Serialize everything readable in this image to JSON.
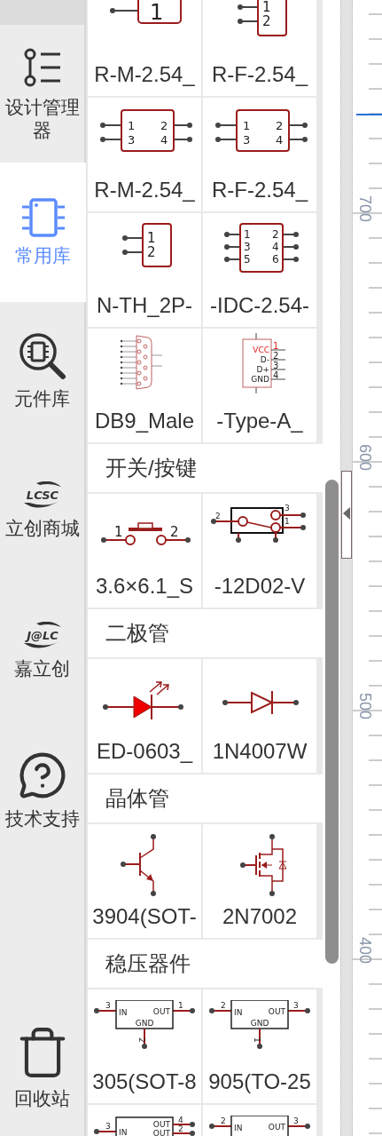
{
  "sidebar": {
    "items": [
      {
        "kind": "tree",
        "label": "设计管理器",
        "selected": false
      },
      {
        "kind": "chip",
        "label": "常用库",
        "selected": true
      },
      {
        "kind": "chip-search",
        "label": "元件库",
        "selected": false
      },
      {
        "kind": "logo",
        "logo_text": "LCSC",
        "label": "立创商城",
        "selected": false
      },
      {
        "kind": "logo",
        "logo_text": "J@LC",
        "label": "嘉立创",
        "selected": false
      },
      {
        "kind": "help",
        "label": "技术支持",
        "selected": false
      },
      {
        "kind": "trash",
        "label": "回收站",
        "selected": false
      }
    ]
  },
  "library": {
    "sections": [
      {
        "rows": [
          [
            {
              "kind": "header-1",
              "name": "R-M-2.54_",
              "pins": [
                "1"
              ]
            },
            {
              "kind": "header-2",
              "name": "R-F-2.54_",
              "pins": [
                "1",
                "2"
              ]
            }
          ],
          [
            {
              "kind": "header-4",
              "name": "R-M-2.54_",
              "pins": [
                "1",
                "2",
                "3",
                "4"
              ]
            },
            {
              "kind": "header-4",
              "name": "R-F-2.54_",
              "pins": [
                "1",
                "2",
                "3",
                "4"
              ]
            }
          ],
          [
            {
              "kind": "header-2",
              "name": "N-TH_2P-",
              "pins": [
                "1",
                "2"
              ]
            },
            {
              "kind": "header-6",
              "name": "-IDC-2.54-",
              "pins": [
                "1",
                "2",
                "3",
                "4",
                "5",
                "6"
              ]
            }
          ],
          [
            {
              "kind": "db9",
              "name": "DB9_Male"
            },
            {
              "kind": "usb",
              "name": "-Type-A_",
              "pins": [
                "VCC",
                "D-",
                "D+",
                "GND",
                "1",
                "2",
                "3",
                "4"
              ]
            }
          ]
        ]
      },
      {
        "title": "开关/按键",
        "rows": [
          [
            {
              "kind": "push-button",
              "name": "3.6×6.1_S",
              "pins": [
                "1",
                "2"
              ]
            },
            {
              "kind": "toggle",
              "name": "-12D02-V",
              "pins": [
                "2",
                "3",
                "1"
              ]
            }
          ]
        ]
      },
      {
        "title": "二极管",
        "rows": [
          [
            {
              "kind": "led",
              "name": "ED-0603_"
            },
            {
              "kind": "diode",
              "name": "1N4007W"
            }
          ]
        ]
      },
      {
        "title": "晶体管",
        "rows": [
          [
            {
              "kind": "npn",
              "name": "3904(SOT-"
            },
            {
              "kind": "nmos",
              "name": "2N7002"
            }
          ]
        ]
      },
      {
        "title": "稳压器件",
        "rows": [
          [
            {
              "kind": "regulator",
              "name": "305(SOT-8",
              "pins": [
                "3",
                "IN",
                "OUT",
                "1",
                "GND",
                "2"
              ]
            },
            {
              "kind": "regulator",
              "name": "905(TO-25",
              "pins": [
                "2",
                "IN",
                "OUT",
                "3",
                "GND",
                "1"
              ]
            }
          ],
          [
            {
              "kind": "regulator-2out",
              "pins": [
                "3",
                "IN",
                "OUT",
                "OUT",
                "4",
                "2"
              ]
            },
            {
              "kind": "regulator",
              "pins": [
                "2",
                "IN",
                "OUT",
                "3"
              ]
            }
          ]
        ]
      }
    ]
  },
  "ruler": {
    "labels": [
      "700",
      "600",
      "500",
      "400"
    ]
  }
}
